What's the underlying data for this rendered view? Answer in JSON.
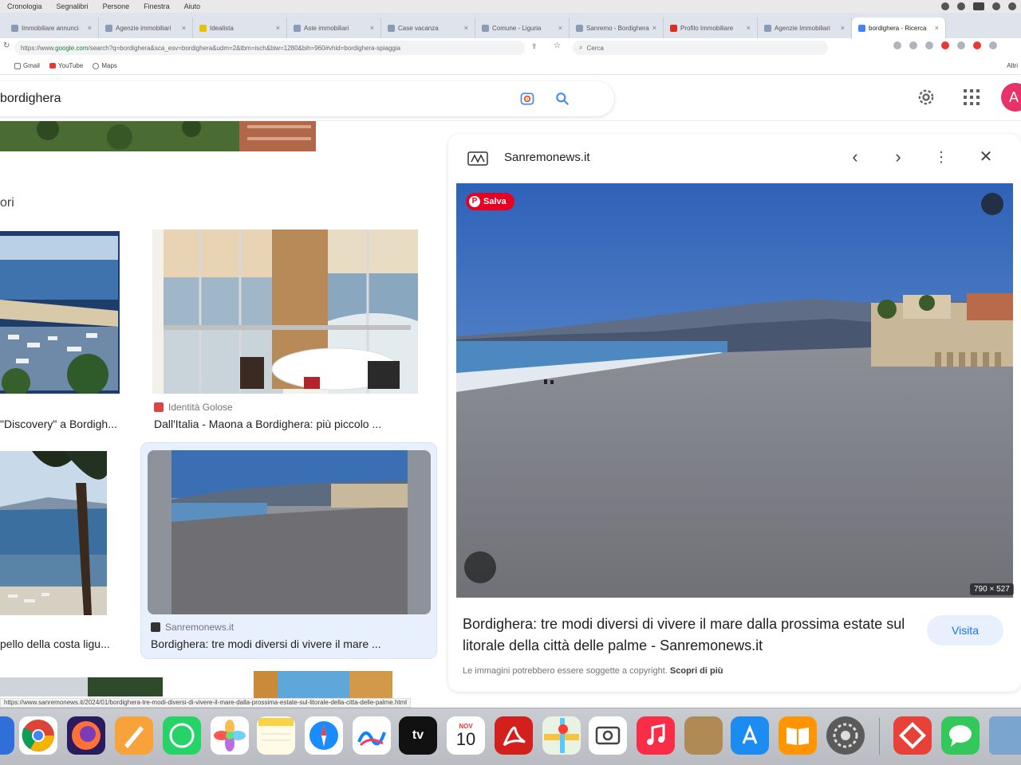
{
  "menubar": {
    "items": [
      "Cronologia",
      "Segnalibri",
      "Persone",
      "Finestra",
      "Aiuto"
    ]
  },
  "tabs": [
    {
      "label": "Immobiliare annunci"
    },
    {
      "label": "Agenzie immobiliari"
    },
    {
      "label": "Idealista"
    },
    {
      "label": "Aste immobiliari"
    },
    {
      "label": "Case vacanza"
    },
    {
      "label": "Comune - Liguria"
    },
    {
      "label": "Sanremo - Bordighera"
    },
    {
      "label": "Profilo Immobiliare"
    },
    {
      "label": "Agenzie Immobiliari"
    },
    {
      "label": "bordighera - Ricerca"
    }
  ],
  "address": {
    "url_prefix": "https://www.",
    "url_domain": "google.com",
    "url_rest": "/search?q=bordighera&sca_esv=bordighera&udm=2&tbm=isch&biw=1280&bih=960#vhid=bordighera-spiaggia",
    "find_placeholder": "Cerca"
  },
  "bookmarks": {
    "items": [
      {
        "label": "Gmail",
        "icon": "gmail-icon"
      },
      {
        "label": "YouTube",
        "icon": "youtube-icon"
      },
      {
        "label": "Maps",
        "icon": "maps-icon"
      }
    ],
    "right_label": "Altri"
  },
  "search": {
    "query": "bordighera"
  },
  "avatar": {
    "letter": "A",
    "color": "#e8336a"
  },
  "left_results": {
    "section_label": "ori",
    "items": [
      {
        "source": "",
        "title": "\"Discovery\" a Bordigh..."
      },
      {
        "source": "Identità Golose",
        "title": "Dall'Italia - Maona a Bordighera: più piccolo ..."
      },
      {
        "source": "",
        "title": "pello della costa ligu..."
      },
      {
        "source": "Sanremonews.it",
        "title": "Bordighera: tre modi diversi di vivere il mare ..."
      }
    ]
  },
  "panel": {
    "site": "Sanremonews.it",
    "save_label": "Salva",
    "dimensions": "790 × 527",
    "title": "Bordighera: tre modi diversi di vivere il mare dalla prossima estate sul litorale della città delle palme - Sanremonews.it",
    "visit_label": "Visita",
    "copyright_text": "Le immagini potrebbero essere soggette a copyright.",
    "copyright_link": "Scopri di più"
  },
  "status_url": "https://www.sanremonews.it/2024/01/bordighera-tre-modi-diversi-di-vivere-il-mare-dalla-prossima-estate-sul-litorale-della-citta-delle-palme.html",
  "dock": {
    "calendar_month": "NOV",
    "calendar_day": "10",
    "appletv_label": "tv"
  },
  "colors": {
    "accent": "#1a73e8",
    "pinterest_red": "#e60023",
    "visit_bg": "#e8f0fe"
  }
}
